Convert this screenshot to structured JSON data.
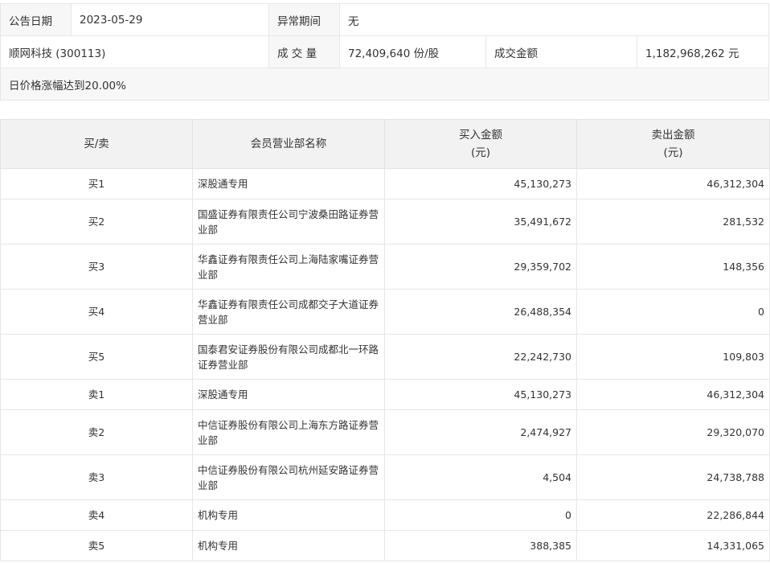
{
  "info": {
    "date_label": "公告日期",
    "date_value": "2023-05-29",
    "abnormal_label": "异常期间",
    "abnormal_value": "无",
    "stock": "顺网科技 (300113)",
    "volume_label": "成 交 量",
    "volume_value": "72,409,640 份/股",
    "amount_label": "成交金额",
    "amount_value": "1,182,968,262 元",
    "reason": "日价格涨幅达到20.00%"
  },
  "table": {
    "headers": [
      "买/卖",
      "会员营业部名称",
      "买入金额\n(元)",
      "卖出金额\n(元)"
    ],
    "rows": [
      {
        "side": "买1",
        "name": "深股通专用",
        "buy": "45,130,273",
        "sell": "46,312,304"
      },
      {
        "side": "买2",
        "name": "国盛证券有限责任公司宁波桑田路证券营业部",
        "buy": "35,491,672",
        "sell": "281,532"
      },
      {
        "side": "买3",
        "name": "华鑫证券有限责任公司上海陆家嘴证券营业部",
        "buy": "29,359,702",
        "sell": "148,356"
      },
      {
        "side": "买4",
        "name": "华鑫证券有限责任公司成都交子大道证券营业部",
        "buy": "26,488,354",
        "sell": "0"
      },
      {
        "side": "买5",
        "name": "国泰君安证券股份有限公司成都北一环路证券营业部",
        "buy": "22,242,730",
        "sell": "109,803"
      },
      {
        "side": "卖1",
        "name": "深股通专用",
        "buy": "45,130,273",
        "sell": "46,312,304"
      },
      {
        "side": "卖2",
        "name": "中信证券股份有限公司上海东方路证券营业部",
        "buy": "2,474,927",
        "sell": "29,320,070"
      },
      {
        "side": "卖3",
        "name": "中信证券股份有限公司杭州延安路证券营业部",
        "buy": "4,504",
        "sell": "24,738,788"
      },
      {
        "side": "卖4",
        "name": "机构专用",
        "buy": "0",
        "sell": "22,286,844"
      },
      {
        "side": "卖5",
        "name": "机构专用",
        "buy": "388,385",
        "sell": "14,331,065"
      }
    ]
  }
}
